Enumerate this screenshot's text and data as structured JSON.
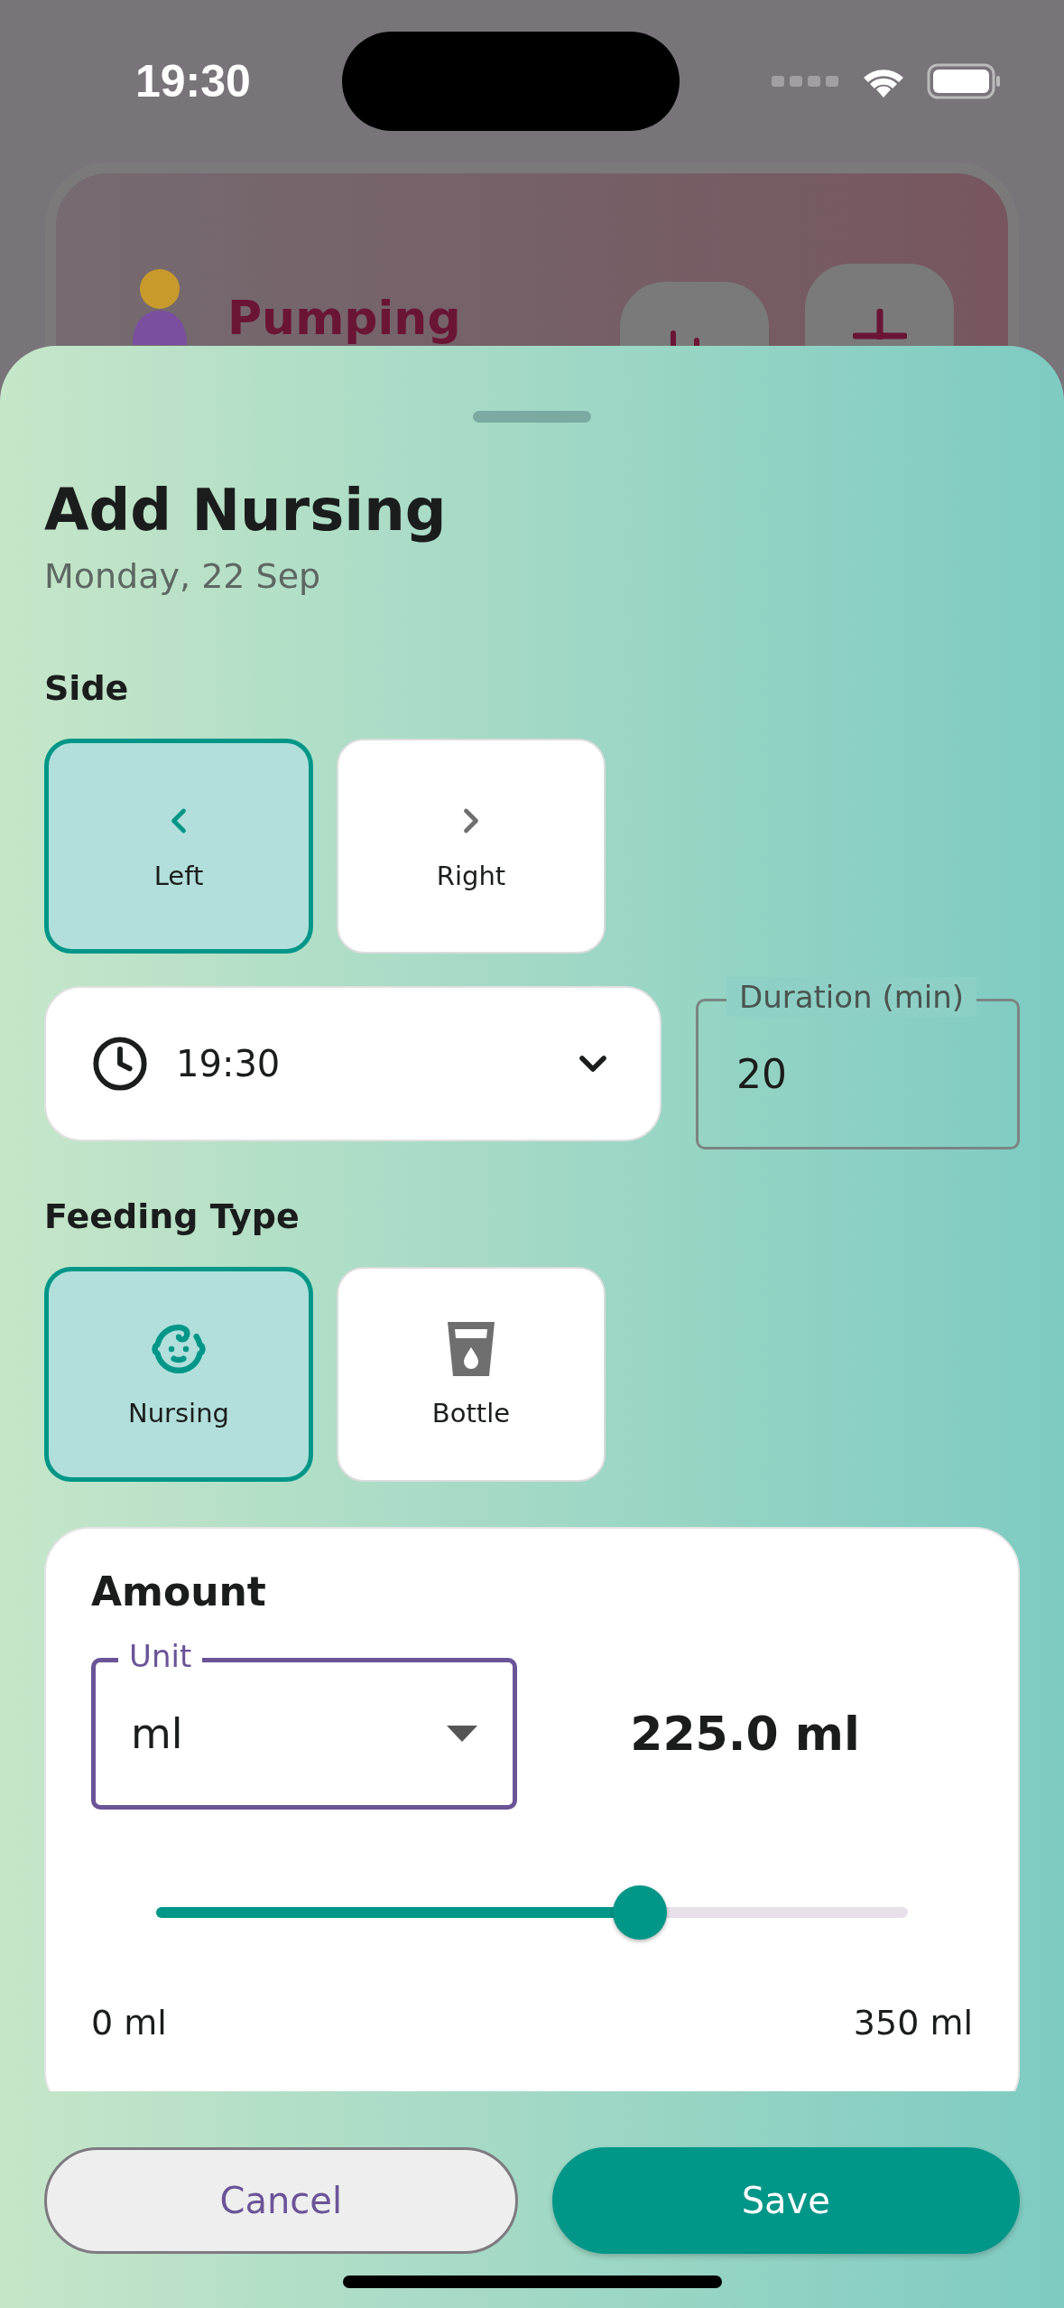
{
  "status_bar": {
    "time": "19:30"
  },
  "background_card": {
    "title": "Pumping"
  },
  "sheet": {
    "title": "Add Nursing",
    "date": "Monday, 22 Sep",
    "side": {
      "label": "Side",
      "options": [
        {
          "label": "Left",
          "selected": true
        },
        {
          "label": "Right",
          "selected": false
        }
      ]
    },
    "time_field": {
      "value": "19:30"
    },
    "duration_field": {
      "label": "Duration (min)",
      "value": "20"
    },
    "feeding_type": {
      "label": "Feeding Type",
      "options": [
        {
          "label": "Nursing",
          "selected": true
        },
        {
          "label": "Bottle",
          "selected": false
        }
      ]
    },
    "amount": {
      "title": "Amount",
      "unit_field": {
        "label": "Unit",
        "value": "ml"
      },
      "reading": "225.0 ml",
      "level": 0.643,
      "min_label": "0 ml",
      "max_label": "350 ml"
    },
    "buttons": [
      {
        "label": "Cancel",
        "kind": "secondary"
      },
      {
        "label": "Save",
        "kind": "primary"
      }
    ]
  }
}
